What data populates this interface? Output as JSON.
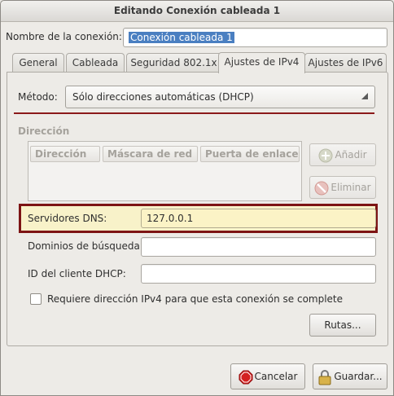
{
  "window": {
    "title": "Editando Conexión cableada 1"
  },
  "connection": {
    "name_label": "Nombre de la conexión:",
    "name_value": "Conexión cableada 1"
  },
  "tabs": [
    {
      "label": "General"
    },
    {
      "label": "Cableada"
    },
    {
      "label": "Seguridad 802.1x"
    },
    {
      "label": "Ajustes de IPv4"
    },
    {
      "label": "Ajustes de IPv6"
    }
  ],
  "ipv4": {
    "method_label": "Método:",
    "method_value": "Sólo direcciones automáticas (DHCP)",
    "address_section": "Dirección",
    "columns": [
      "Dirección",
      "Máscara de red",
      "Puerta de enlace"
    ],
    "add_label": "Añadir",
    "delete_label": "Eliminar",
    "dns_label": "Servidores DNS:",
    "dns_value": "127.0.0.1",
    "search_domains_label": "Dominios de búsqueda:",
    "search_domains_value": "",
    "dhcp_client_id_label": "ID del cliente DHCP:",
    "dhcp_client_id_value": "",
    "require_ipv4_label": "Requiere dirección IPv4 para que esta conexión se complete",
    "require_ipv4_checked": false,
    "routes_label": "Rutas..."
  },
  "footer": {
    "cancel_label": "Cancelar",
    "save_label": "Guardar..."
  },
  "colors": {
    "highlight_border": "#7d1414",
    "dns_field_bg": "#fbf3c6",
    "selection_bg": "#4a7fc1"
  },
  "icons": {
    "add": "plus-circle-icon",
    "delete": "no-entry-icon",
    "cancel": "stop-sign-icon",
    "save": "padlock-icon",
    "combo_arrow": "triangle-down-icon"
  }
}
